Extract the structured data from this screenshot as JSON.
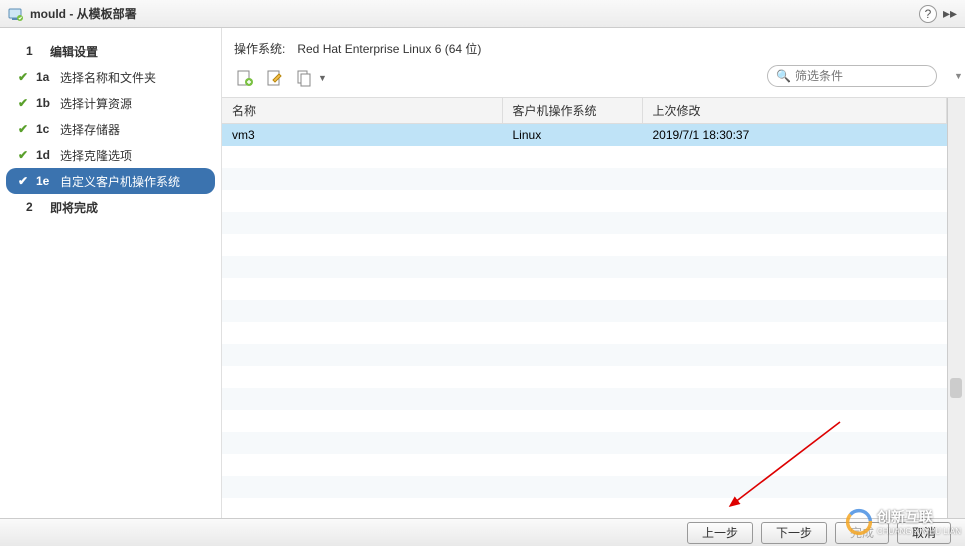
{
  "title": "mould - 从模板部署",
  "sidebar": {
    "steps": [
      {
        "num": "1",
        "label": "编辑设置",
        "major": true,
        "done": false,
        "active": false
      },
      {
        "num": "1a",
        "label": "选择名称和文件夹",
        "major": false,
        "done": true,
        "active": false
      },
      {
        "num": "1b",
        "label": "选择计算资源",
        "major": false,
        "done": true,
        "active": false
      },
      {
        "num": "1c",
        "label": "选择存储器",
        "major": false,
        "done": true,
        "active": false
      },
      {
        "num": "1d",
        "label": "选择克隆选项",
        "major": false,
        "done": true,
        "active": false
      },
      {
        "num": "1e",
        "label": "自定义客户机操作系统",
        "major": false,
        "done": true,
        "active": true
      },
      {
        "num": "2",
        "label": "即将完成",
        "major": true,
        "done": false,
        "active": false
      }
    ]
  },
  "os_label": "操作系统:",
  "os_value": "Red Hat Enterprise Linux 6 (64 位)",
  "filter_placeholder": "筛选条件",
  "table": {
    "headers": [
      "名称",
      "客户机操作系统",
      "上次修改"
    ],
    "rows": [
      {
        "name": "vm3",
        "guest": "Linux",
        "modified": "2019/7/1 18:30:37",
        "selected": true
      }
    ]
  },
  "buttons": {
    "back": "上一步",
    "next": "下一步",
    "finish": "完成",
    "cancel": "取消"
  },
  "watermark": {
    "brand": "创新互联",
    "sub": "CHUANG XIN HU LIAN"
  }
}
